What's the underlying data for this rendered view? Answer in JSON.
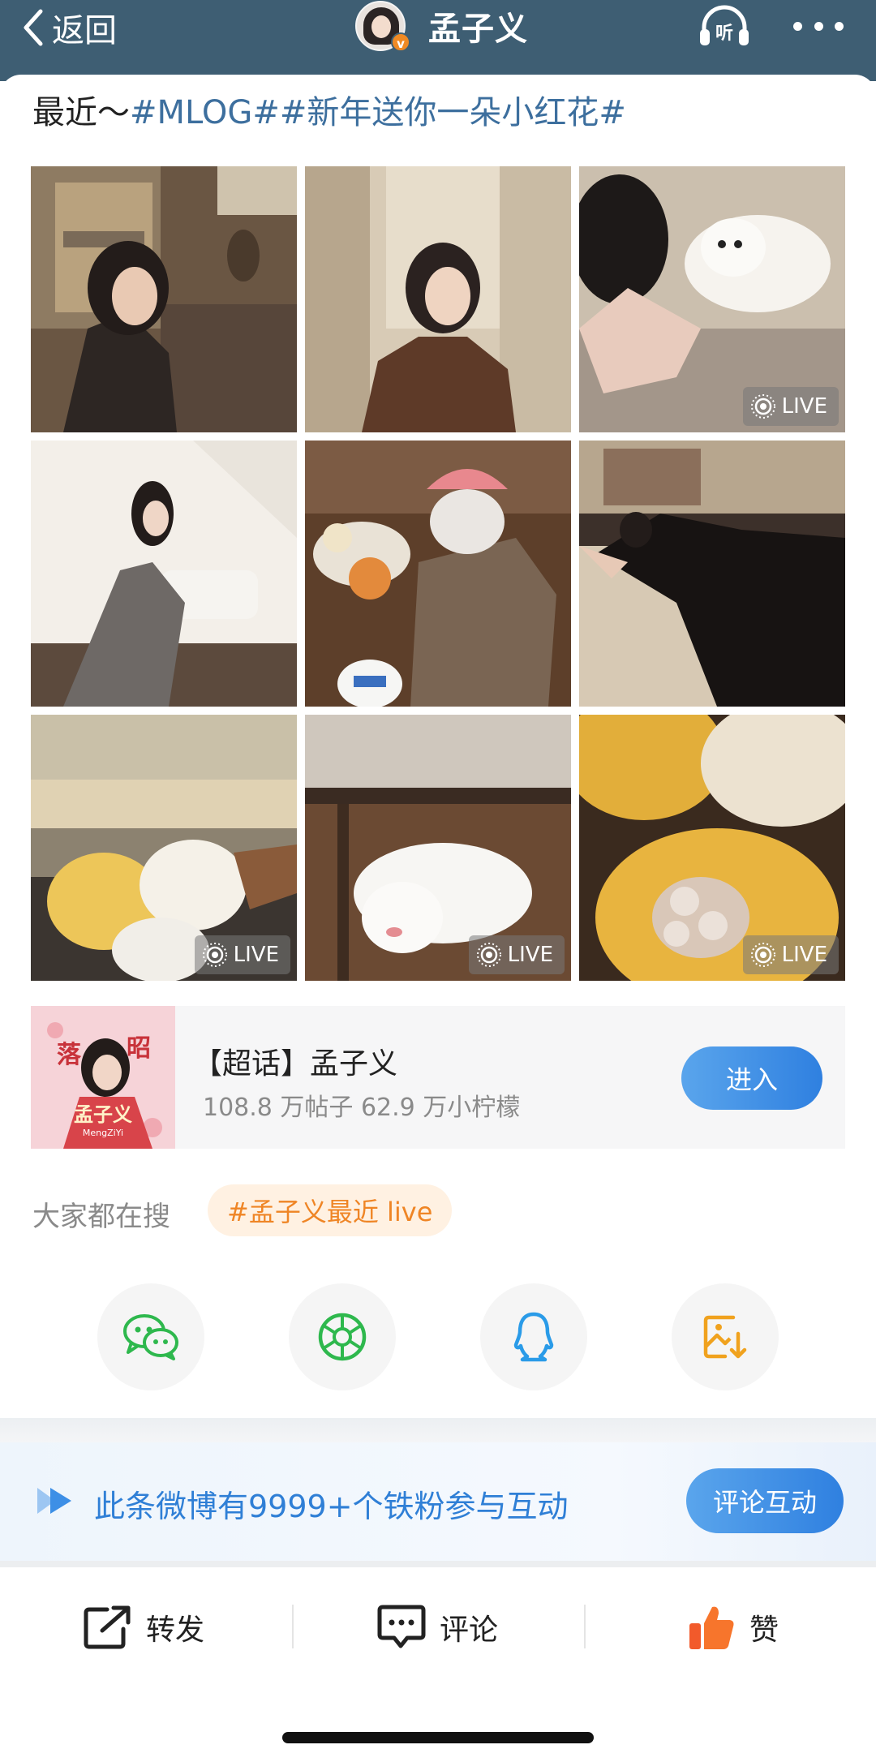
{
  "nav": {
    "back_label": "返回",
    "user_name": "孟子义",
    "verified_badge": "v",
    "listen_label": "听",
    "more_icon": "more-dots-icon",
    "bar_color": "#3e5e73"
  },
  "post": {
    "text_prefix": "最近～",
    "hashtags": "#MLOG##新年送你一朵小红花#"
  },
  "grid": {
    "live_label": "LIVE"
  },
  "supertopic": {
    "title": "【超话】孟子义",
    "stats": "108.8 万帖子 62.9 万小柠檬",
    "enter_label": "进入",
    "thumb_text_1": "落",
    "thumb_text_2": "昭",
    "thumb_text_3": "孟子义",
    "thumb_text_4": "MengZiYi"
  },
  "search": {
    "label": "大家都在搜",
    "tag": "#孟子义最近 live"
  },
  "share": [
    {
      "icon": "wechat-icon",
      "color": "#2eb84d"
    },
    {
      "icon": "moments-icon",
      "color": "#2eb84d"
    },
    {
      "icon": "qq-icon",
      "color": "#2a9be8"
    },
    {
      "icon": "save-image-icon",
      "color": "#f0a21e"
    }
  ],
  "fans_banner": {
    "text": "此条微博有9999+个铁粉参与互动",
    "button_label": "评论互动"
  },
  "actions": {
    "repost_label": "转发",
    "comment_label": "评论",
    "like_label": "赞"
  },
  "colors": {
    "accent_blue": "#2f80e0",
    "tag_orange": "#ef8525",
    "hashtag_blue": "#3d6f9e"
  }
}
